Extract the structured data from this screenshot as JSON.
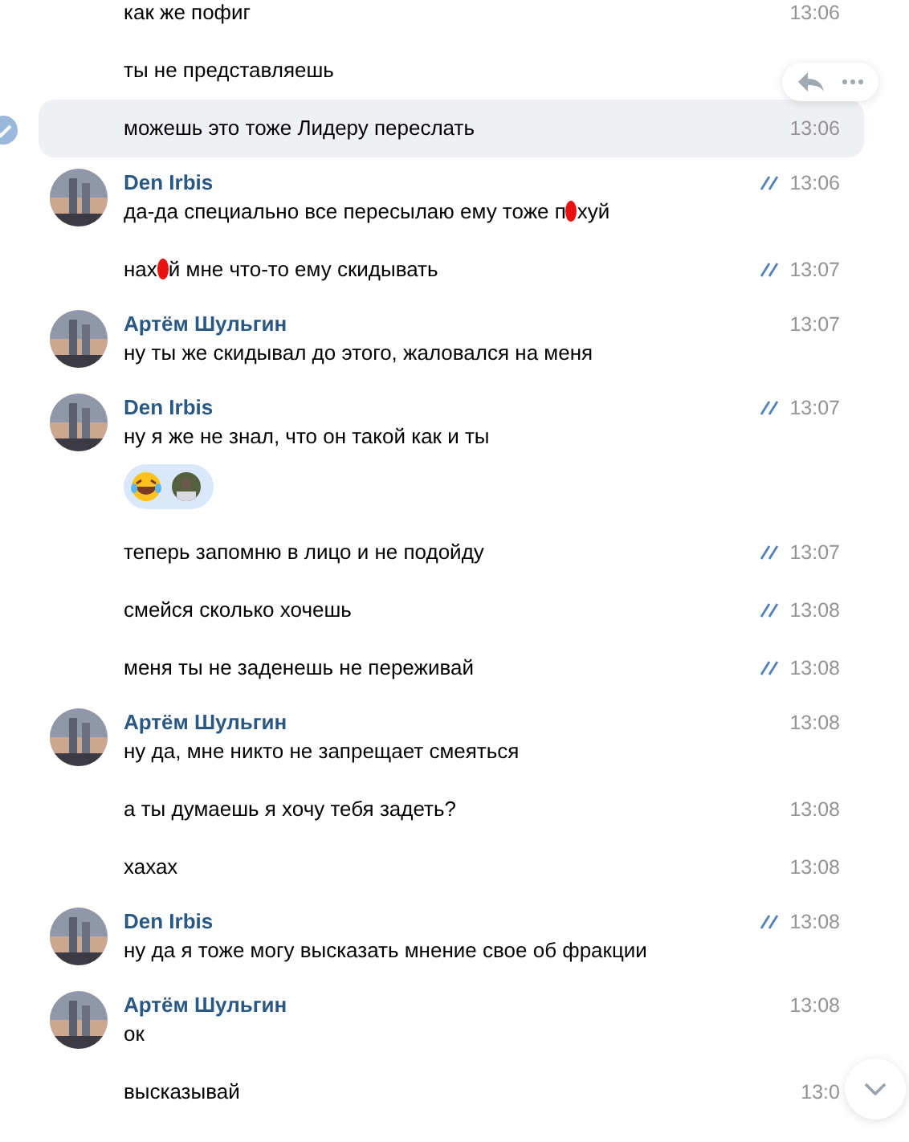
{
  "messages": [
    {
      "kind": "cont",
      "text": [
        "как же пофиг"
      ],
      "time": "13:06",
      "read": false,
      "selected": false
    },
    {
      "kind": "cont",
      "text": [
        "ты не представляешь"
      ],
      "read": false,
      "selected": false
    },
    {
      "kind": "cont",
      "text": [
        "можешь это тоже Лидеру переслать"
      ],
      "time": "13:06",
      "read": false,
      "selected": true
    },
    {
      "kind": "first",
      "author": "Den Irbis",
      "avatar": {
        "kind": "picture"
      },
      "text": [
        "да-да специально все пересылаю ему тоже п",
        "хуй"
      ],
      "time": "13:06",
      "read": true,
      "selected": false
    },
    {
      "kind": "cont",
      "text": [
        "нах",
        "й мне что-то ему скидывать"
      ],
      "time": "13:07",
      "read": true,
      "selected": false
    },
    {
      "kind": "first",
      "author": "Артём Шульгин",
      "avatar": {
        "kind": "picture"
      },
      "text": [
        "ну ты же скидывал до этого, жаловался на меня"
      ],
      "time": "13:07",
      "read": false,
      "selected": false
    },
    {
      "kind": "first",
      "author": "Den Irbis",
      "avatar": {
        "kind": "picture"
      },
      "text": [
        "ну я же не знал, что он такой как и ты"
      ],
      "time": "13:07",
      "read": true,
      "selected": false,
      "reaction": true
    },
    {
      "kind": "cont",
      "text": [
        "теперь запомню в лицо и не подойду"
      ],
      "time": "13:07",
      "read": true,
      "selected": false
    },
    {
      "kind": "cont",
      "text": [
        "смейся сколько хочешь"
      ],
      "time": "13:08",
      "read": true,
      "selected": false
    },
    {
      "kind": "cont",
      "text": [
        "меня ты не заденешь не переживай"
      ],
      "time": "13:08",
      "read": true,
      "selected": false
    },
    {
      "kind": "first",
      "author": "Артём Шульгин",
      "avatar": {
        "kind": "picture"
      },
      "text": [
        "ну да, мне никто не запрещает смеяться"
      ],
      "time": "13:08",
      "read": false,
      "selected": false
    },
    {
      "kind": "cont",
      "text": [
        "а ты думаешь я хочу тебя задеть?"
      ],
      "time": "13:08",
      "read": false,
      "selected": false
    },
    {
      "kind": "cont",
      "text": [
        "хахах"
      ],
      "time": "13:08",
      "read": false,
      "selected": false
    },
    {
      "kind": "first",
      "author": "Den Irbis",
      "avatar": {
        "kind": "picture"
      },
      "text": [
        "ну да я тоже могу высказать мнение свое об фракции"
      ],
      "time": "13:08",
      "read": true,
      "selected": false
    },
    {
      "kind": "first",
      "author": "Артём Шульгин",
      "avatar": {
        "kind": "picture"
      },
      "text": [
        "ок"
      ],
      "time": "13:08",
      "read": false,
      "selected": false
    },
    {
      "kind": "cont",
      "text": [
        "высказывай"
      ],
      "time": "13:0",
      "read": false,
      "selected": false
    }
  ]
}
